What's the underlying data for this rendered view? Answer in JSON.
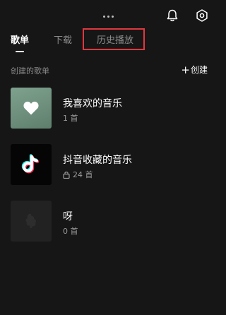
{
  "tabs": [
    {
      "label": "歌单",
      "active": true
    },
    {
      "label": "下载",
      "active": false
    },
    {
      "label": "历史播放",
      "active": false
    }
  ],
  "section": {
    "title": "创建的歌单",
    "create_plus": "+",
    "create_label": "创建"
  },
  "playlists": [
    {
      "name": "我喜欢的音乐",
      "count": "1 首",
      "cover": "heart-icon",
      "locked": false
    },
    {
      "name": "抖音收藏的音乐",
      "count": "24 首",
      "cover": "tiktok-logo-icon",
      "locked": true
    },
    {
      "name": "呀",
      "count": "0 首",
      "cover": "empty-cover",
      "locked": false
    }
  ],
  "colors": {
    "background": "#161616",
    "highlight_box": "#e0383e",
    "favorite_cover": "#7ea28e",
    "tiktok_cyan": "#25f4ee",
    "tiktok_red": "#fe2c55"
  }
}
